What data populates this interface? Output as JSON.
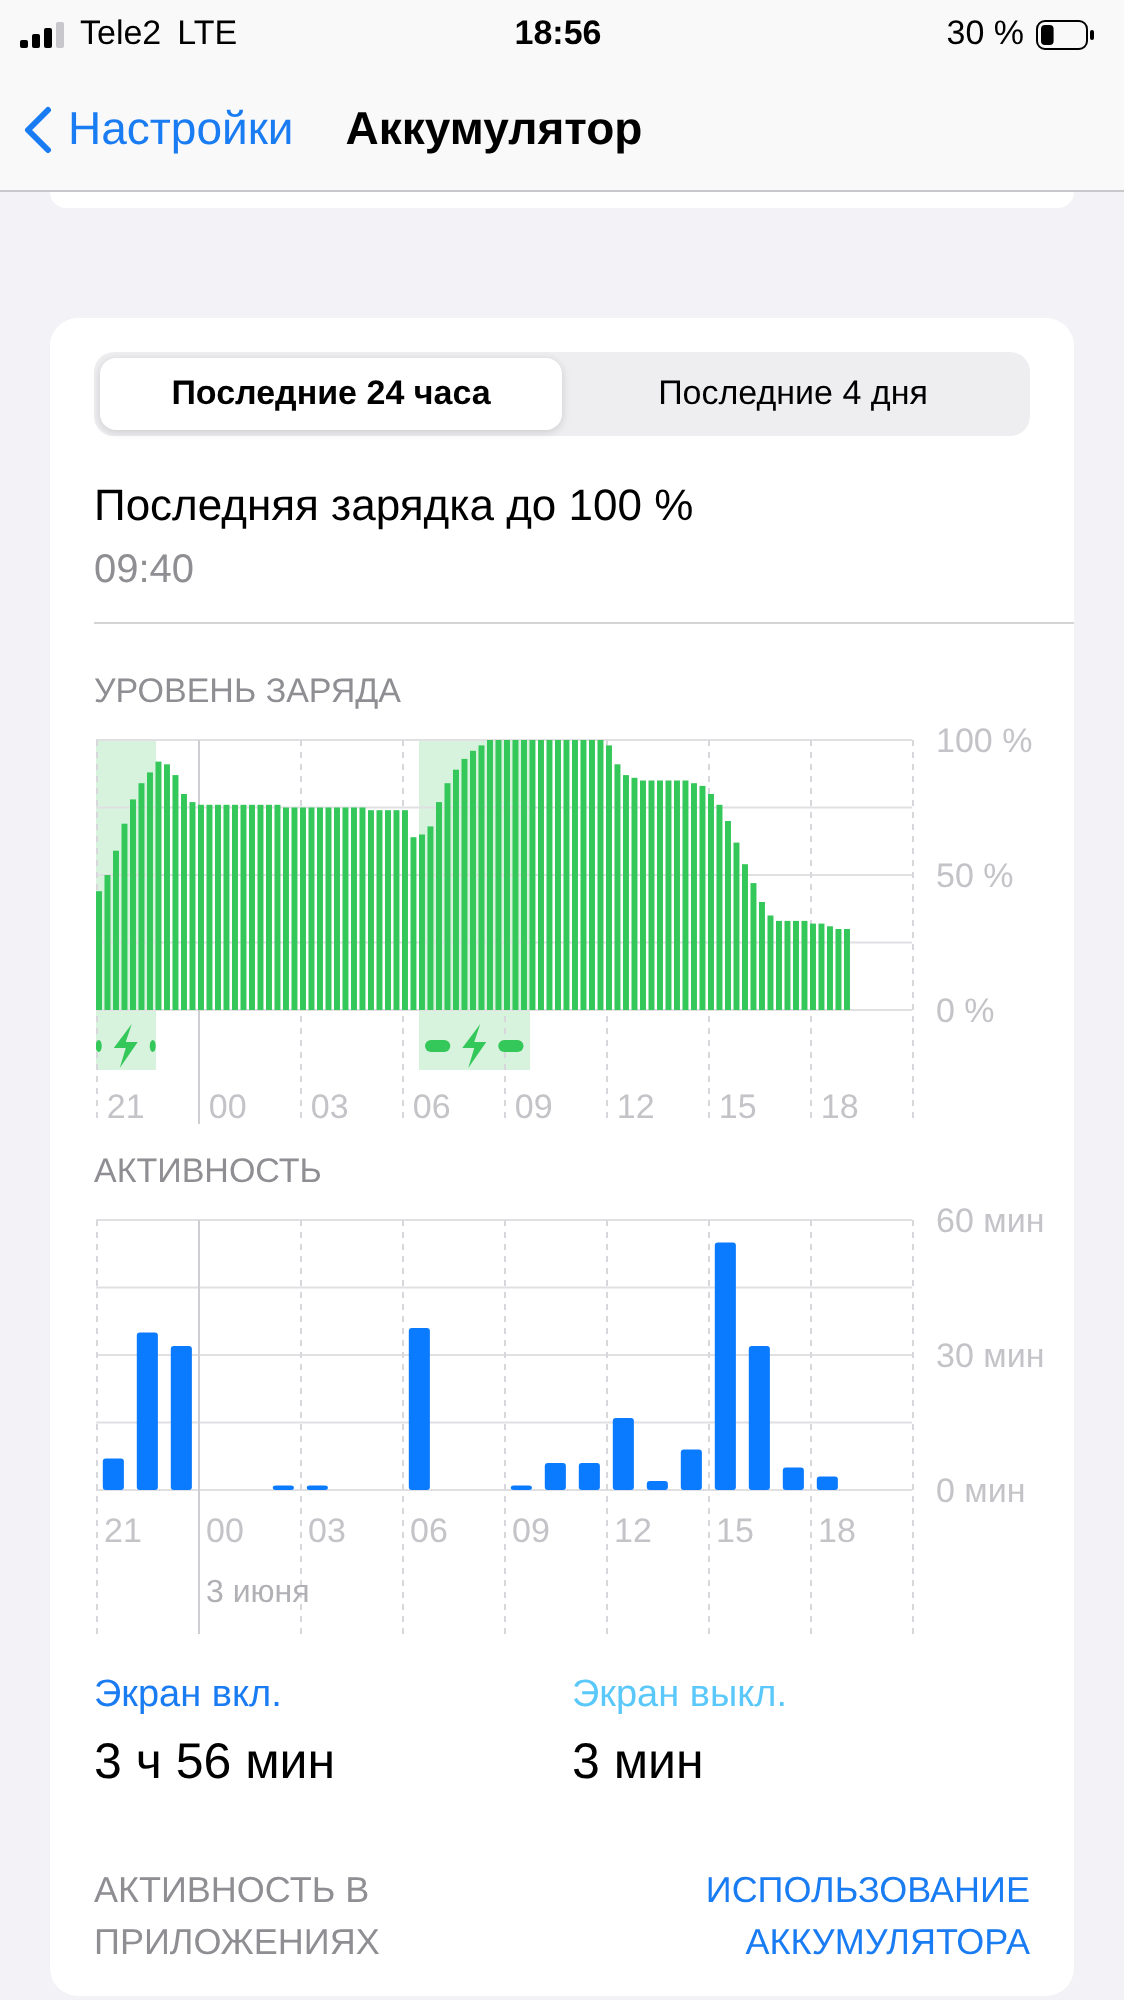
{
  "status_bar": {
    "carrier": "Tele2",
    "network": "LTE",
    "time": "18:56",
    "battery_text": "30 %"
  },
  "nav": {
    "back": "Настройки",
    "title": "Аккумулятор"
  },
  "tabs": [
    {
      "label": "Последние 24 часа",
      "selected": true
    },
    {
      "label": "Последние 4 дня",
      "selected": false
    }
  ],
  "last_charge": {
    "title": "Последняя зарядка до 100 %",
    "time": "09:40"
  },
  "battery_chart": {
    "title": "УРОВЕНЬ ЗАРЯДА",
    "charging": [
      true,
      true,
      true,
      true,
      true,
      true,
      true,
      false,
      false,
      false,
      false,
      false,
      false,
      false,
      false,
      false,
      false,
      false,
      false,
      false,
      false,
      false,
      false,
      false,
      false,
      false,
      false,
      false,
      false,
      false,
      false,
      false,
      false,
      false,
      false,
      false,
      false,
      false,
      true,
      true,
      true,
      true,
      true,
      true,
      true,
      true,
      true,
      true,
      true,
      true,
      true,
      false,
      false,
      false,
      false,
      false,
      false,
      false,
      false,
      false,
      false,
      false,
      false,
      false,
      false,
      false,
      false,
      false,
      false,
      false,
      false,
      false,
      false,
      false,
      false,
      false,
      false,
      false,
      false,
      false,
      false,
      false,
      false,
      false,
      false,
      false,
      false,
      false,
      false
    ],
    "chart_data": {
      "type": "bar",
      "ylim": [
        0,
        100
      ],
      "yticks": [
        {
          "value": 100,
          "label": "100 %"
        },
        {
          "value": 50,
          "label": "50 %"
        },
        {
          "value": 0,
          "label": "0 %"
        }
      ],
      "categories": [
        null,
        null,
        null,
        "21",
        null,
        null,
        null,
        null,
        null,
        null,
        null,
        null,
        null,
        null,
        null,
        "00",
        null,
        null,
        null,
        null,
        null,
        null,
        null,
        null,
        null,
        null,
        null,
        "03",
        null,
        null,
        null,
        null,
        null,
        null,
        null,
        null,
        null,
        null,
        null,
        "06",
        null,
        null,
        null,
        null,
        null,
        null,
        null,
        null,
        null,
        null,
        null,
        "09",
        null,
        null,
        null,
        null,
        null,
        null,
        null,
        null,
        null,
        null,
        null,
        "12",
        null,
        null,
        null,
        null,
        null,
        null,
        null,
        null,
        null,
        null,
        null,
        "15",
        null,
        null,
        null,
        null,
        null,
        null,
        null,
        null,
        null,
        null,
        null,
        "18",
        null,
        null,
        null,
        null,
        null,
        null,
        null,
        null
      ],
      "series": [
        {
          "color": "#34c759",
          "values": [
            44,
            50,
            59,
            69,
            78,
            84,
            88,
            92,
            91,
            87,
            80,
            77,
            76,
            76,
            76,
            76,
            76,
            76,
            76,
            76,
            76,
            76,
            75,
            75,
            75,
            75,
            75,
            75,
            75,
            75,
            75,
            75,
            74,
            74,
            74,
            74,
            74,
            64,
            65,
            68,
            77,
            84,
            89,
            93,
            96,
            98,
            100,
            100,
            100,
            100,
            100,
            100,
            100,
            100,
            100,
            100,
            100,
            100,
            100,
            100,
            98,
            91,
            87,
            86,
            85,
            85,
            85,
            85,
            85,
            85,
            84,
            83,
            80,
            76,
            70,
            62,
            54,
            47,
            40,
            35,
            33,
            33,
            33,
            33,
            32,
            32,
            31,
            30,
            30,
            null,
            null,
            null,
            null,
            null,
            null,
            null
          ]
        }
      ]
    }
  },
  "activity_chart": {
    "title": "АКТИВНОСТЬ",
    "date_label": "3 июня",
    "chart_data": {
      "type": "bar",
      "ylim": [
        0,
        60
      ],
      "yticks": [
        {
          "value": 60,
          "label": "60 мин"
        },
        {
          "value": 30,
          "label": "30 мин"
        },
        {
          "value": 0,
          "label": "0 мин"
        }
      ],
      "categories": [
        "21",
        null,
        null,
        "00",
        null,
        null,
        "03",
        null,
        null,
        "06",
        null,
        null,
        "09",
        null,
        null,
        "12",
        null,
        null,
        "15",
        null,
        null,
        "18",
        null,
        null
      ],
      "series": [
        {
          "color": "#0a7aff",
          "values": [
            7,
            35,
            32,
            0,
            0,
            1,
            1,
            0,
            0,
            36,
            0,
            0,
            1,
            6,
            6,
            16,
            2,
            9,
            55,
            32,
            5,
            3,
            null,
            null
          ]
        }
      ]
    }
  },
  "usage": [
    {
      "label": "Экран вкл.",
      "value": "3 ч 56 мин",
      "color": "#1a7cf2"
    },
    {
      "label": "Экран выкл.",
      "value": "3 мин",
      "color": "#5ac8fa"
    }
  ],
  "footer": {
    "title": "АКТИВНОСТЬ В ПРИЛОЖЕНИЯХ",
    "link": "ИСПОЛЬЗОВАНИЕ АККУМУЛЯТОРА"
  }
}
